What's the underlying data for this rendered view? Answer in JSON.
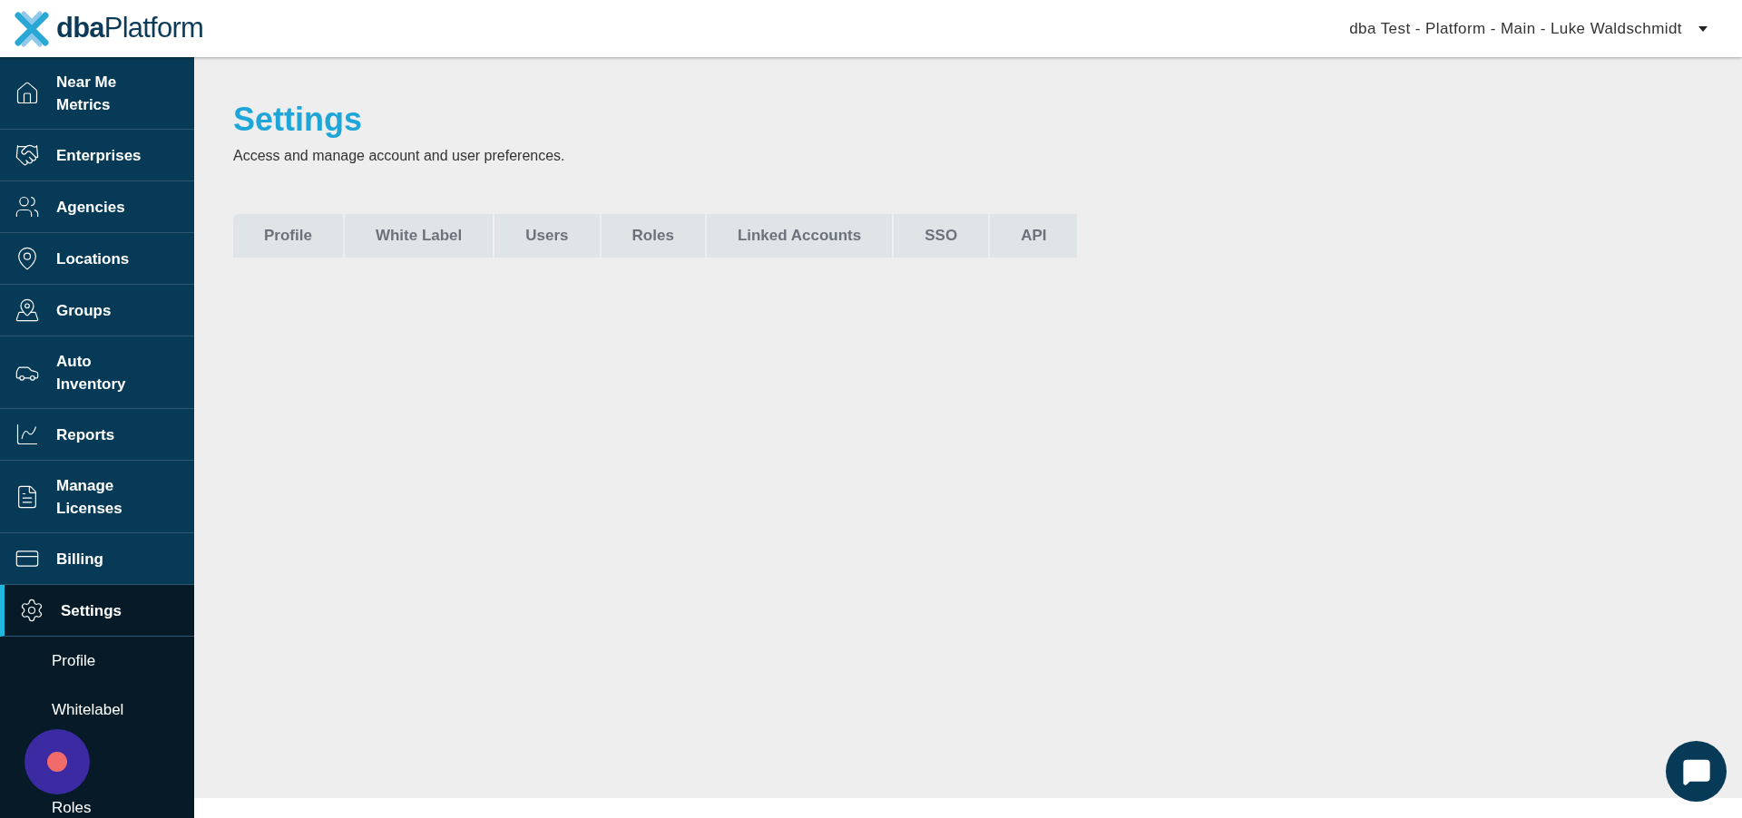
{
  "header": {
    "logo": "**dba**Platform",
    "account": "dba Test - Platform - Main - Luke Waldschmidt"
  },
  "sidebar": {
    "items": [
      {
        "label": "Near Me Metrics",
        "selected": false
      },
      {
        "label": "Enterprises",
        "selected": false
      },
      {
        "label": "Agencies",
        "selected": false
      },
      {
        "label": "Locations",
        "selected": false
      },
      {
        "label": "Groups",
        "selected": false
      },
      {
        "label": "Auto Inventory",
        "selected": false
      },
      {
        "label": "Reports",
        "selected": false
      },
      {
        "label": "Manage Licenses",
        "selected": false
      },
      {
        "label": "Billing",
        "selected": false
      },
      {
        "label": "Settings",
        "selected": true
      }
    ],
    "submenu": [
      {
        "label": "Profile",
        "kind": "item"
      },
      {
        "label": "Whitelabel",
        "kind": "item"
      },
      {
        "kind": "hidden"
      },
      {
        "label": "Roles",
        "kind": "item"
      }
    ]
  },
  "page": {
    "title": "Settings",
    "subtitle": "Access and manage account and user preferences.",
    "tabs": [
      {
        "label": "Profile",
        "selected": false
      },
      {
        "label": "White Label",
        "selected": false
      },
      {
        "label": "Users",
        "selected": false
      },
      {
        "label": "Roles",
        "selected": false
      },
      {
        "label": "Linked Accounts",
        "selected": false
      },
      {
        "label": "SSO",
        "selected": false
      },
      {
        "label": "API",
        "selected": false
      }
    ]
  }
}
